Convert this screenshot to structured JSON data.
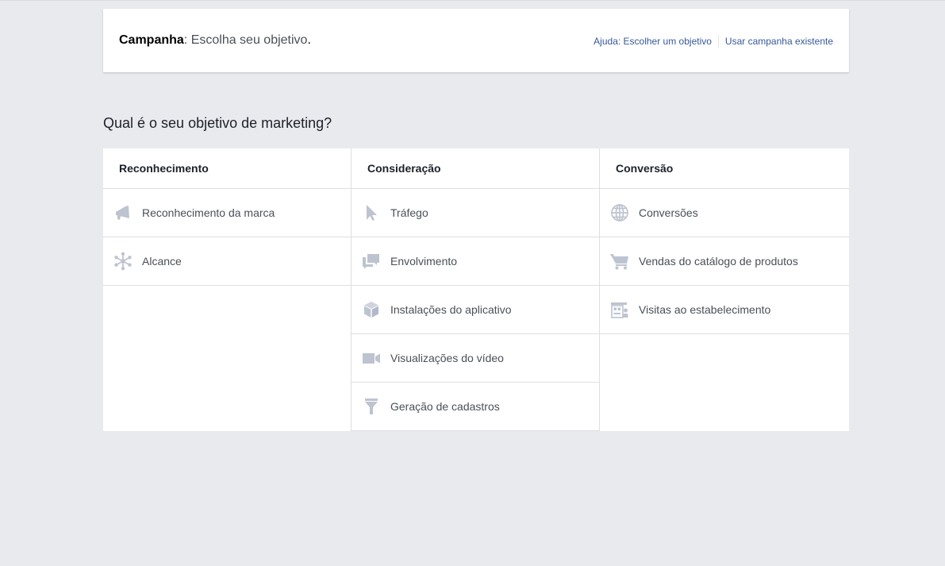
{
  "header": {
    "title_bold": "Campanha",
    "title_rest": ": Escolha seu objetivo",
    "title_dot": ".",
    "help_link": "Ajuda: Escolher um objetivo",
    "existing_link": "Usar campanha existente"
  },
  "question": "Qual é o seu objetivo de marketing?",
  "icon_color": "#bec3d0",
  "columns": [
    {
      "title": "Reconhecimento",
      "items": [
        {
          "label": "Reconhecimento da marca",
          "icon": "megaphone-icon"
        },
        {
          "label": "Alcance",
          "icon": "asterisk-reach-icon"
        }
      ]
    },
    {
      "title": "Consideração",
      "items": [
        {
          "label": "Tráfego",
          "icon": "cursor-icon"
        },
        {
          "label": "Envolvimento",
          "icon": "chat-bubbles-icon"
        },
        {
          "label": "Instalações do aplicativo",
          "icon": "box-icon"
        },
        {
          "label": "Visualizações do vídeo",
          "icon": "video-camera-icon"
        },
        {
          "label": "Geração de cadastros",
          "icon": "funnel-icon"
        }
      ]
    },
    {
      "title": "Conversão",
      "items": [
        {
          "label": "Conversões",
          "icon": "globe-icon"
        },
        {
          "label": "Vendas do catálogo de produtos",
          "icon": "shopping-cart-icon"
        },
        {
          "label": "Visitas ao estabelecimento",
          "icon": "store-icon"
        }
      ]
    }
  ]
}
